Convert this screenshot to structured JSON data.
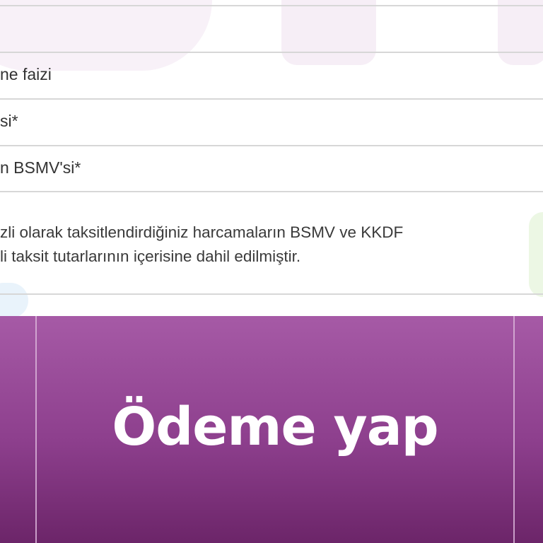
{
  "table": {
    "rows": [
      {
        "label": "ne faizi"
      },
      {
        "label": "si*"
      },
      {
        "label": "n BSMV'si*"
      }
    ],
    "note_lines": [
      "zli olarak taksitlendirdiğiniz harcamaların BSMV ve KKDF",
      "li taksit tutarlarının içerisine dahil edilmiştir."
    ]
  },
  "footer": {
    "pay_button_label": "Ödeme yap"
  },
  "colors": {
    "footer_top": "#a65aa6",
    "footer_bottom": "#6c2569",
    "button_text": "#ffffff"
  }
}
